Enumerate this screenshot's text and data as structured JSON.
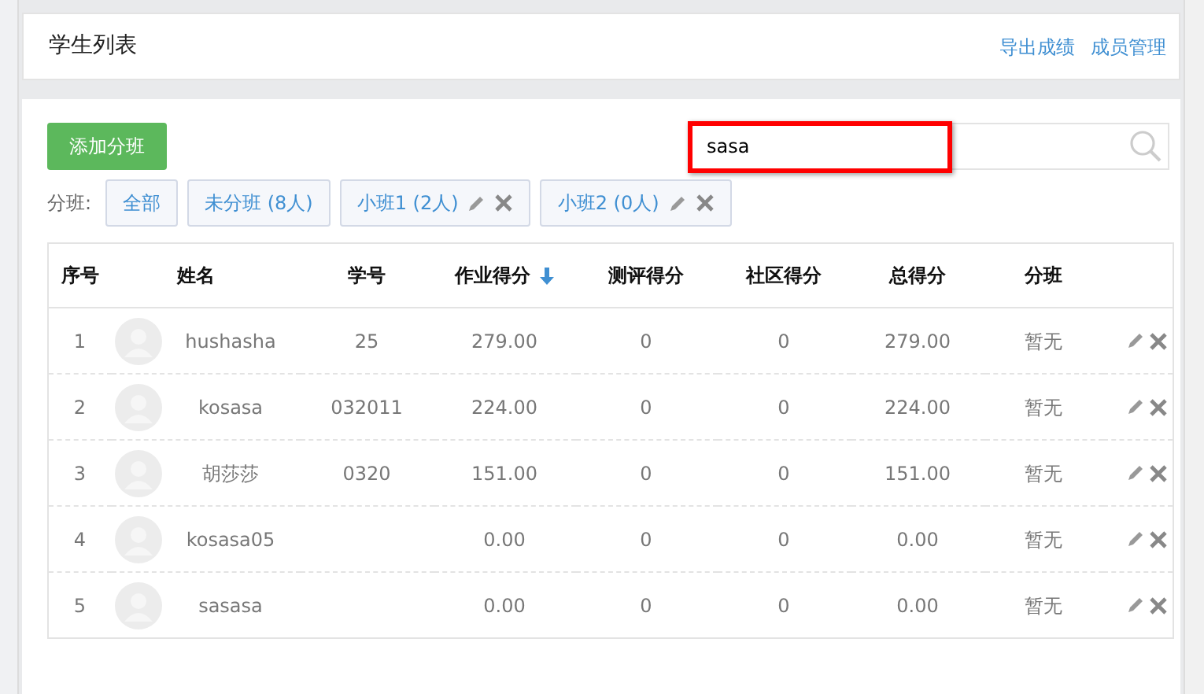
{
  "header": {
    "title": "学生列表",
    "links": [
      "导出成绩",
      "成员管理"
    ]
  },
  "toolbar": {
    "add_button": "添加分班",
    "search": {
      "value": "sasa",
      "highlighted": true
    }
  },
  "filter": {
    "label": "分班:",
    "chips": [
      {
        "label": "全部",
        "kind": "plain"
      },
      {
        "label": "未分班 (8人)",
        "kind": "plain"
      },
      {
        "label": "小班1 (2人)",
        "kind": "group"
      },
      {
        "label": "小班2 (0人)",
        "kind": "group"
      }
    ]
  },
  "table": {
    "columns": [
      {
        "label": "序号",
        "sorted": false
      },
      {
        "label": "姓名",
        "sorted": false
      },
      {
        "label": "学号",
        "sorted": false
      },
      {
        "label": "作业得分",
        "sorted": true
      },
      {
        "label": "测评得分",
        "sorted": false
      },
      {
        "label": "社区得分",
        "sorted": false
      },
      {
        "label": "总得分",
        "sorted": false
      },
      {
        "label": "分班",
        "sorted": false
      }
    ],
    "rows": [
      {
        "index": "1",
        "name": "hushasha",
        "student_id": "25",
        "homework": "279.00",
        "test": "0",
        "community": "0",
        "total": "279.00",
        "group": "暂无"
      },
      {
        "index": "2",
        "name": "kosasa",
        "student_id": "032011",
        "homework": "224.00",
        "test": "0",
        "community": "0",
        "total": "224.00",
        "group": "暂无"
      },
      {
        "index": "3",
        "name": "胡莎莎",
        "student_id": "0320",
        "homework": "151.00",
        "test": "0",
        "community": "0",
        "total": "151.00",
        "group": "暂无"
      },
      {
        "index": "4",
        "name": "kosasa05",
        "homework": "0.00",
        "test": "0",
        "community": "0",
        "total": "0.00",
        "group": "暂无"
      },
      {
        "index": "5",
        "name": "sasasa",
        "homework": "0.00",
        "test": "0",
        "community": "0",
        "total": "0.00",
        "group": "暂无"
      }
    ]
  }
}
